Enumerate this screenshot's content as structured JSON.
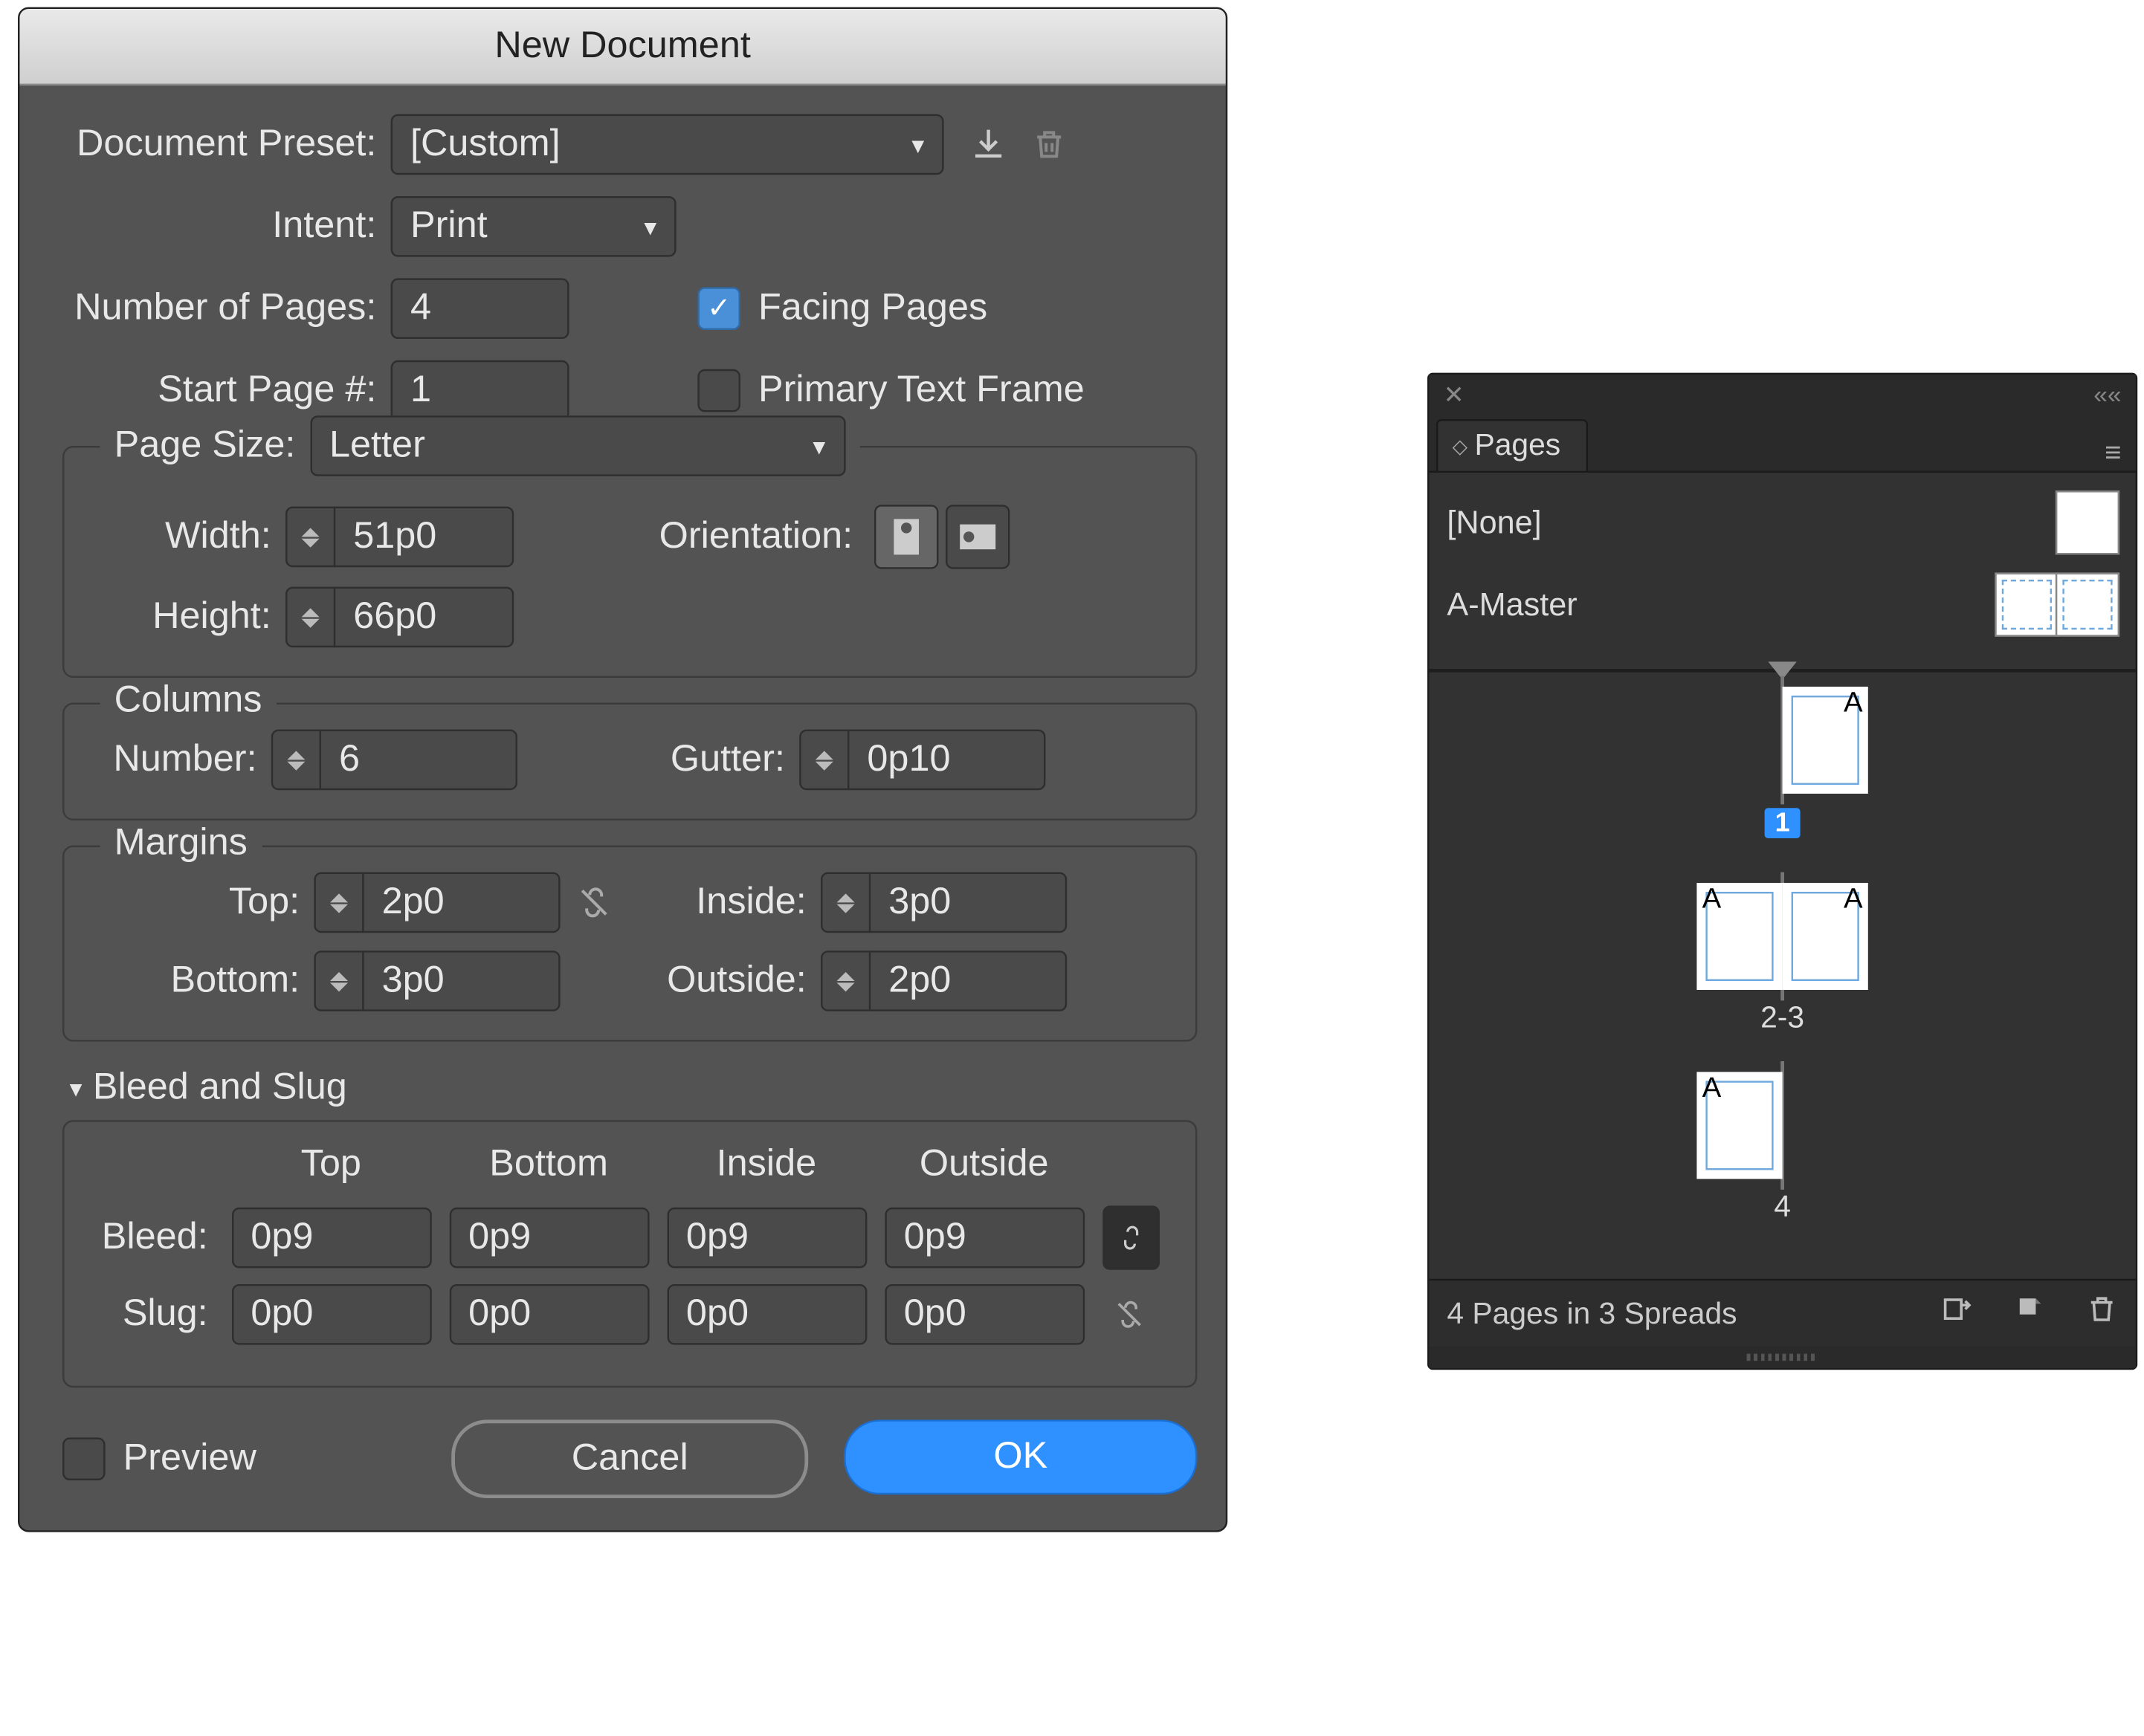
{
  "dialog": {
    "title": "New Document",
    "preset": {
      "label": "Document Preset:",
      "value": "[Custom]"
    },
    "intent": {
      "label": "Intent:",
      "value": "Print"
    },
    "numPages": {
      "label": "Number of Pages:",
      "value": "4"
    },
    "startPage": {
      "label": "Start Page #:",
      "value": "1"
    },
    "facingPages": {
      "label": "Facing Pages",
      "checked": true
    },
    "primaryTextFrame": {
      "label": "Primary Text Frame",
      "checked": false
    },
    "pageSize": {
      "legend": "Page Size:",
      "value": "Letter",
      "widthLabel": "Width:",
      "width": "51p0",
      "heightLabel": "Height:",
      "height": "66p0",
      "orientationLabel": "Orientation:"
    },
    "columns": {
      "legend": "Columns",
      "numberLabel": "Number:",
      "number": "6",
      "gutterLabel": "Gutter:",
      "gutter": "0p10"
    },
    "margins": {
      "legend": "Margins",
      "topLabel": "Top:",
      "top": "2p0",
      "bottomLabel": "Bottom:",
      "bottom": "3p0",
      "insideLabel": "Inside:",
      "inside": "3p0",
      "outsideLabel": "Outside:",
      "outside": "2p0",
      "linked": false
    },
    "bleedSlug": {
      "header": "Bleed and Slug",
      "colTop": "Top",
      "colBottom": "Bottom",
      "colInside": "Inside",
      "colOutside": "Outside",
      "bleedLabel": "Bleed:",
      "bleedTop": "0p9",
      "bleedBottom": "0p9",
      "bleedInside": "0p9",
      "bleedOutside": "0p9",
      "bleedLinked": true,
      "slugLabel": "Slug:",
      "slugTop": "0p0",
      "slugBottom": "0p0",
      "slugInside": "0p0",
      "slugOutside": "0p0",
      "slugLinked": false
    },
    "preview": {
      "label": "Preview",
      "checked": false
    },
    "buttons": {
      "cancel": "Cancel",
      "ok": "OK"
    }
  },
  "pagesPanel": {
    "title": "Pages",
    "masters": {
      "none": "[None]",
      "a": "A-Master"
    },
    "spreads": {
      "s1": {
        "corner": "A",
        "label": "1"
      },
      "s2": {
        "cornerL": "A",
        "cornerR": "A",
        "label": "2-3"
      },
      "s3": {
        "corner": "A",
        "label": "4"
      }
    },
    "status": "4 Pages in 3 Spreads"
  }
}
